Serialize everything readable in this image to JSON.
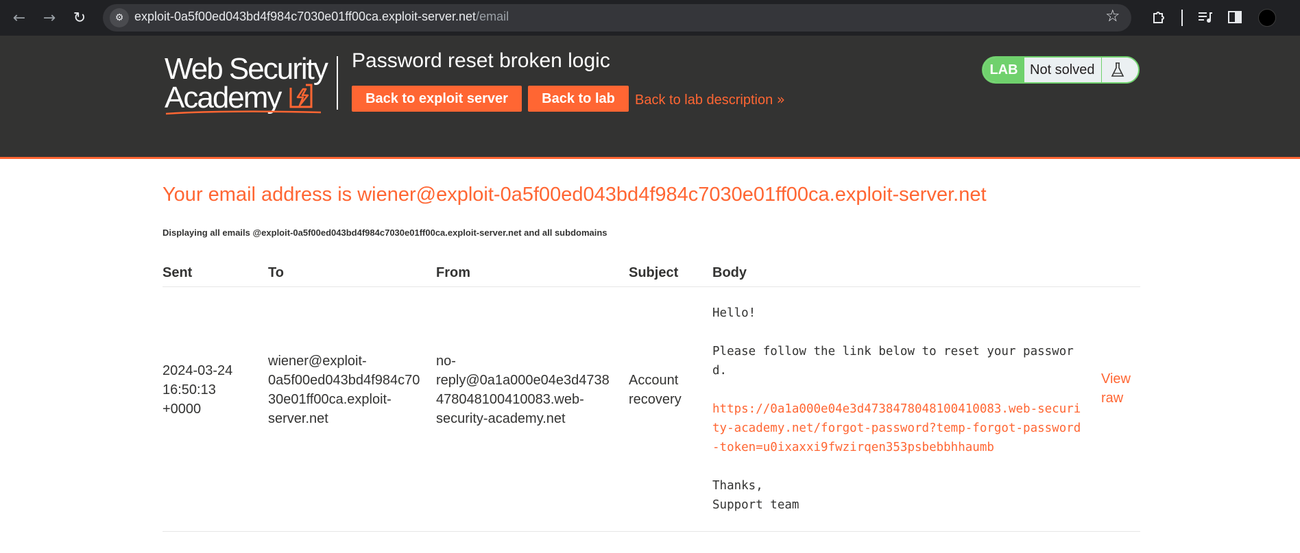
{
  "browser": {
    "url_host": "exploit-0a5f00ed043bd4f984c7030e01ff00ca.exploit-server.net",
    "url_path": "/email",
    "icons": {
      "back": "arrow-left-icon",
      "forward": "arrow-right-icon",
      "reload": "reload-icon",
      "site_info": "tune-icon",
      "bookmark": "star-icon",
      "extensions": "puzzle-icon",
      "media": "media-control-icon",
      "side_panel": "side-panel-icon",
      "profile": "avatar"
    }
  },
  "header": {
    "logo_line1": "Web Security",
    "logo_line2": "Academy",
    "lab_title": "Password reset broken logic",
    "back_to_exploit_server": "Back to exploit server",
    "back_to_lab": "Back to lab",
    "back_to_lab_description": "Back to lab description",
    "lab_badge_tag": "LAB",
    "lab_status": "Not solved",
    "accent_color": "#ff6633",
    "background_color": "#333332",
    "status_color": "#70d16d"
  },
  "main": {
    "email_heading": "Your email address is wiener@exploit-0a5f00ed043bd4f984c7030e01ff00ca.exploit-server.net",
    "display_note": "Displaying all emails @exploit-0a5f00ed043bd4f984c7030e01ff00ca.exploit-server.net and all subdomains",
    "table": {
      "headers": [
        "Sent",
        "To",
        "From",
        "Subject",
        "Body"
      ],
      "rows": [
        {
          "sent_line1": "2024-03-24",
          "sent_line2": "16:50:13",
          "sent_line3": "+0000",
          "to_line1": "wiener@exploit-",
          "to_line2": "0a5f00ed043bd4f984c70",
          "to_line3": "30e01ff00ca.exploit-",
          "to_line4": "server.net",
          "from_line1": "no-",
          "from_line2": "reply@0a1a000e04e3d4738",
          "from_line3": "478048100410083.web-",
          "from_line4": "security-academy.net",
          "subject_line1": "Account",
          "subject_line2": "recovery",
          "body_greeting": "Hello!",
          "body_text": "Please follow the link below to reset your password.",
          "body_link": "https://0a1a000e04e3d4738478048100410083.web-security-academy.net/forgot-password?temp-forgot-password-token=u0ixaxxi9fwzirqen353psbebbhhaumb",
          "body_thanks": "Thanks,",
          "body_signature": "Support team",
          "view_raw_line1": "View",
          "view_raw_line2": "raw"
        }
      ]
    }
  }
}
